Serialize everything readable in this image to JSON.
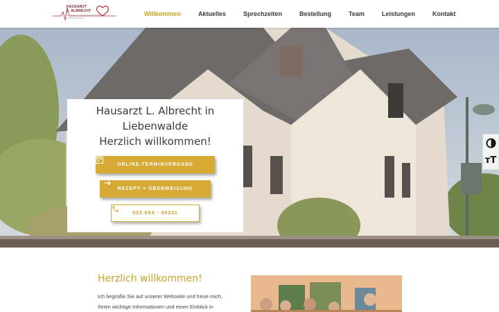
{
  "logo": {
    "line1": "HAUSARZT",
    "line2": "L. ALBRECHT",
    "subtitle": "FACHARZT FÜR INNERE MEDIZIN · NOTFALLMEDIZIN",
    "icon": "heart-pulse-icon"
  },
  "nav": {
    "items": [
      "Willkommen",
      "Aktuelles",
      "Sprechzeiten",
      "Bestellung",
      "Team",
      "Leistungen",
      "Kontakt"
    ],
    "active_index": 0
  },
  "hero": {
    "title_line1": "Hausarzt L. Albrecht in",
    "title_line2": "Liebenwalde",
    "title_line3": "Herzlich willkommen!",
    "btn_online": "ONLINE-TERMINVERGABE",
    "btn_online_icon": "calendar-icon",
    "btn_rezept": "REZEPT + ÜBERWEISUNG",
    "btn_rezept_icon": "arrow-right-icon",
    "btn_phone": "033 054 - 60211",
    "btn_phone_icon": "phone-icon"
  },
  "accessibility": {
    "contrast_icon": "contrast-icon",
    "font_size_icon": "text-size-icon",
    "font_size_label": "ᴛT"
  },
  "welcome": {
    "title": "Herzlich willkommen!",
    "text": "Ich begrüße Sie auf unserer Webseite und freue mich, Ihnen wichtige Informationen und einen Einblick in"
  },
  "colors": {
    "accent": "#d7a935",
    "accent_text": "#c9a227",
    "nav_text": "#3a3a3a",
    "logo_red": "#7a1f2b"
  }
}
